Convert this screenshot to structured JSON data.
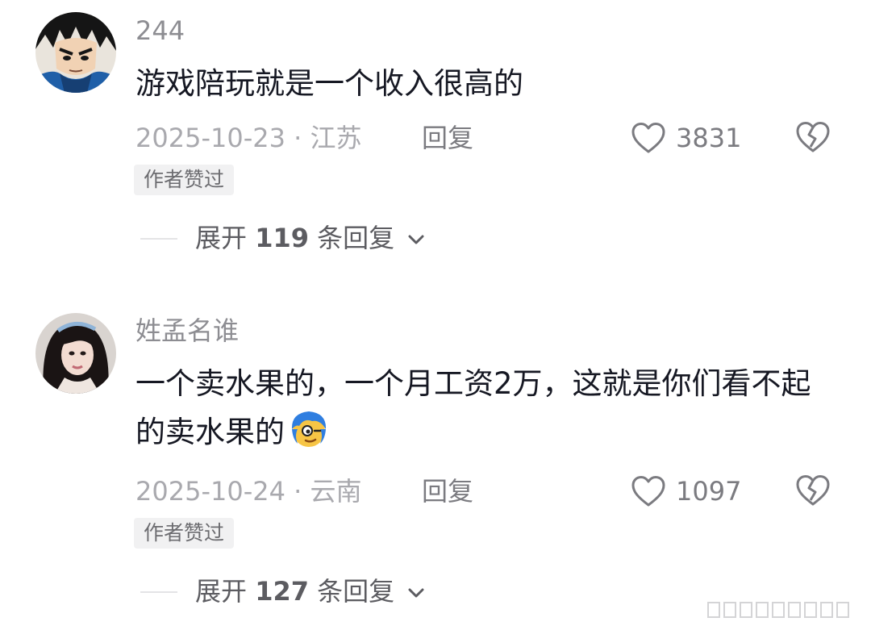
{
  "comments": [
    {
      "username": "244",
      "text": "游戏陪玩就是一个收入很高的",
      "date_location": "2025-10-23 · 江苏",
      "reply_label": "回复",
      "like_count": "3831",
      "author_badge": "作者赞过",
      "expand_prefix": "展开",
      "expand_count": "119",
      "expand_suffix": "条回复"
    },
    {
      "username": "姓孟名谁",
      "text": "一个卖水果的，一个月工资2万，这就是你们看不起的卖水果的",
      "date_location": "2025-10-24 · 云南",
      "reply_label": "回复",
      "like_count": "1097",
      "author_badge": "作者赞过",
      "expand_prefix": "展开",
      "expand_count": "127",
      "expand_suffix": "条回复"
    }
  ],
  "icons": {
    "like": "heart-outline-icon",
    "dislike": "broken-heart-icon",
    "expand": "chevron-down-icon",
    "emoji": "blue-hair-emoji-icon"
  },
  "colors": {
    "text_primary": "#161823",
    "text_secondary": "#8d8d92",
    "badge_bg": "#f1f1f2"
  }
}
